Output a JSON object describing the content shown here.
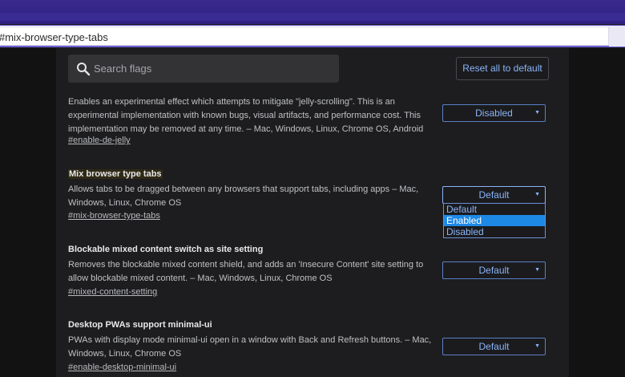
{
  "address_bar": {
    "url": "#mix-browser-type-tabs"
  },
  "search": {
    "placeholder": "Search flags"
  },
  "toolbar": {
    "reset_label": "Reset all to default"
  },
  "flags": [
    {
      "title": "",
      "description": "Enables an experimental effect which attempts to mitigate \"jelly-scrolling\". This is an experimental implementation with known bugs, visual artifacts, and performance cost. This implementation may be removed at any time. – Mac, Windows, Linux, Chrome OS, Android",
      "link": "#enable-de-jelly",
      "value": "Disabled"
    },
    {
      "title": "Mix browser type tabs",
      "description": "Allows tabs to be dragged between any browsers that support tabs, including apps – Mac, Windows, Linux, Chrome OS",
      "link": "#mix-browser-type-tabs",
      "value": "Default",
      "options": [
        "Default",
        "Enabled",
        "Disabled"
      ],
      "highlighted_option": "Enabled"
    },
    {
      "title": "Blockable mixed content switch as site setting",
      "description": "Removes the blockable mixed content shield, and adds an 'Insecure Content' site setting to allow blockable mixed content. – Mac, Windows, Linux, Chrome OS",
      "link": "#mixed-content-setting",
      "value": "Default"
    },
    {
      "title": "Desktop PWAs support minimal-ui",
      "description": "PWAs with display mode minimal-ui open in a window with Back and Refresh buttons. – Mac, Windows, Linux, Chrome OS",
      "link": "#enable-desktop-minimal-ui",
      "value": "Default"
    }
  ],
  "icons": {
    "search": "search-icon",
    "caret": "caret-down-icon"
  },
  "colors": {
    "accent": "#8ab4f8",
    "selected_option": "#1e88e5",
    "background": "#1d1d1f",
    "browser_frame": "#3b2a8f"
  }
}
